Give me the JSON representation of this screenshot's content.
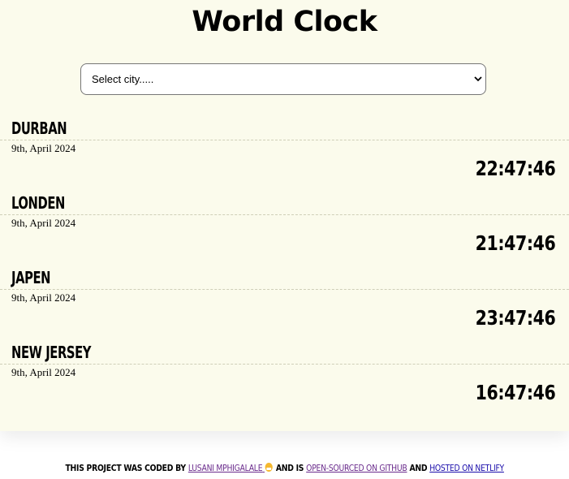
{
  "app": {
    "title": "World Clock"
  },
  "select": {
    "placeholder": "Select city.....",
    "options": [
      "Select city....."
    ]
  },
  "cities": [
    {
      "name": "DURBAN",
      "date": "9th, April 2024",
      "time": "22:47:46"
    },
    {
      "name": "LONDEN",
      "date": "9th, April 2024",
      "time": "21:47:46"
    },
    {
      "name": "JAPEN",
      "date": "9th, April 2024",
      "time": "23:47:46"
    },
    {
      "name": "NEW JERSEY",
      "date": "9th, April 2024",
      "time": "16:47:46"
    }
  ],
  "footer": {
    "prefix": "THIS PROJECT WAS CODED BY",
    "author_link": "LUSANI MPHIGALALE",
    "emoji_icon": "grinning-face-icon",
    "middle": "AND IS",
    "github_link": "OPEN-SOURCED ON GITHUB",
    "and": "AND",
    "netlify_link": "HOSTED ON NETLIFY"
  },
  "colors": {
    "background": "#fbfbec",
    "visited_link": "#6a2b8c",
    "link": "#1a0dab"
  }
}
